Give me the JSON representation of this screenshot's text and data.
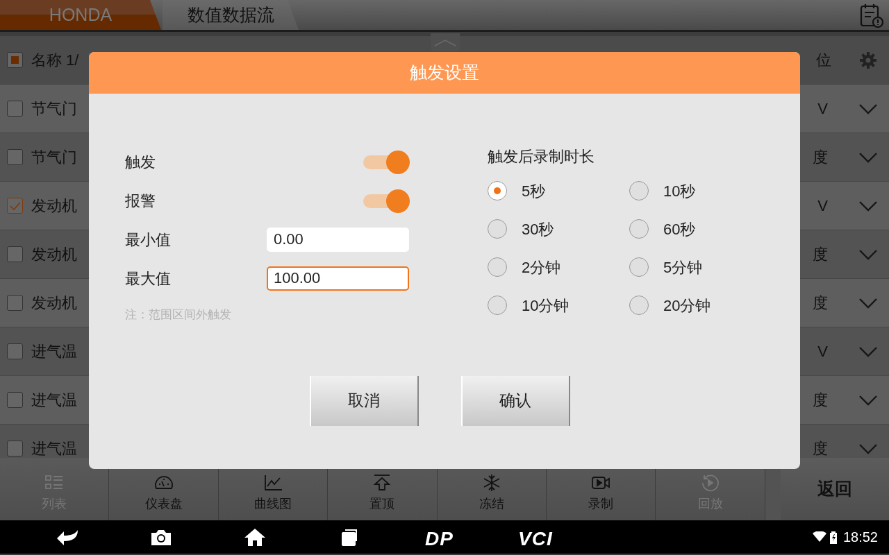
{
  "top_bar": {
    "breadcrumbs": [
      {
        "label": "HONDA"
      },
      {
        "label": "数值数据流"
      }
    ]
  },
  "table": {
    "header": {
      "indeterminate": true,
      "name": "名称 1/",
      "unit": "位"
    },
    "rows": [
      {
        "name": "节气门",
        "unit": "V",
        "checked": false
      },
      {
        "name": "节气门",
        "unit": "度",
        "checked": false
      },
      {
        "name": "发动机",
        "unit": "V",
        "checked": true
      },
      {
        "name": "发动机",
        "unit": "度",
        "checked": false
      },
      {
        "name": "发动机",
        "unit": "度",
        "checked": false
      },
      {
        "name": "进气温",
        "unit": "V",
        "checked": false
      },
      {
        "name": "进气温",
        "unit": "度",
        "checked": false
      },
      {
        "name": "进气温",
        "unit": "度",
        "checked": false
      }
    ]
  },
  "dialog": {
    "title": "触发设置",
    "toggles": [
      {
        "label": "触发",
        "on": true
      },
      {
        "label": "报警",
        "on": true
      }
    ],
    "fields": [
      {
        "label": "最小值",
        "value": "0.00",
        "focused": false
      },
      {
        "label": "最大值",
        "value": "100.00",
        "focused": true
      }
    ],
    "note": "注：范围区间外触发",
    "duration": {
      "label": "触发后录制时长",
      "options": [
        {
          "label": "5秒",
          "selected": true
        },
        {
          "label": "10秒",
          "selected": false
        },
        {
          "label": "30秒",
          "selected": false
        },
        {
          "label": "60秒",
          "selected": false
        },
        {
          "label": "2分钟",
          "selected": false
        },
        {
          "label": "5分钟",
          "selected": false
        },
        {
          "label": "10分钟",
          "selected": false
        },
        {
          "label": "20分钟",
          "selected": false
        }
      ]
    },
    "buttons": [
      "取消",
      "确认"
    ]
  },
  "toolbar": {
    "items": [
      {
        "kind": "list",
        "label": "列表",
        "disabled": true
      },
      {
        "kind": "gauge",
        "label": "仪表盘",
        "disabled": false
      },
      {
        "kind": "chart",
        "label": "曲线图",
        "disabled": false
      },
      {
        "kind": "top",
        "label": "置顶",
        "disabled": false
      },
      {
        "kind": "freeze",
        "label": "冻结",
        "disabled": false
      },
      {
        "kind": "record",
        "label": "录制",
        "disabled": false
      },
      {
        "kind": "playback",
        "label": "回放",
        "disabled": true
      }
    ],
    "back": "返回"
  },
  "nav_bar": {
    "logos": [
      "DP",
      "VCI"
    ],
    "time": "18:52"
  }
}
